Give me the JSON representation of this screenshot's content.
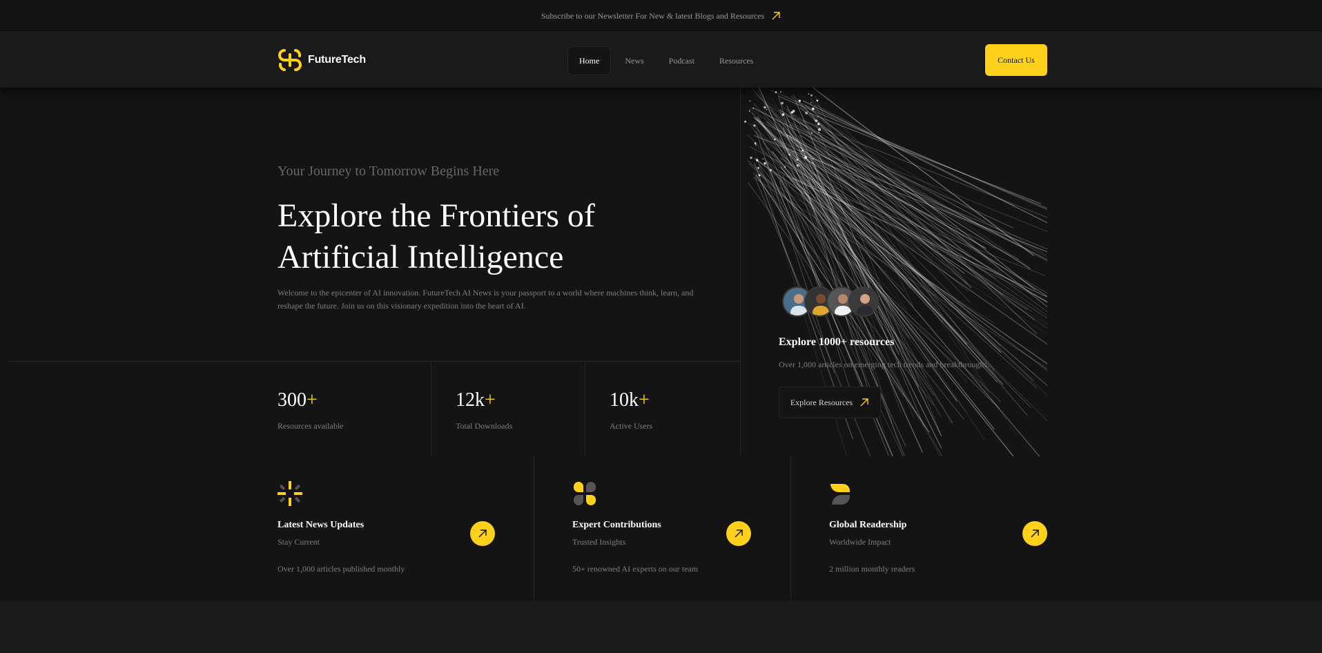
{
  "banner": {
    "text": "Subscribe to our Newsletter For New & latest Blogs and Resources"
  },
  "header": {
    "logo_text": "FutureTech",
    "nav": [
      {
        "label": "Home",
        "active": true
      },
      {
        "label": "News",
        "active": false
      },
      {
        "label": "Podcast",
        "active": false
      },
      {
        "label": "Resources",
        "active": false
      }
    ],
    "contact_label": "Contact Us"
  },
  "hero": {
    "tagline": "Your Journey to Tomorrow Begins Here",
    "headline_1": "Explore the Frontiers of",
    "headline_2": "Artificial Intelligence",
    "description": "Welcome to the epicenter of AI innovation. FutureTech AI News is your passport to a world where machines think, learn, and reshape the future. Join us on this visionary expedition into the heart of AI."
  },
  "stats": [
    {
      "value": "300",
      "suffix": "+",
      "label": "Resources available"
    },
    {
      "value": "12k",
      "suffix": "+",
      "label": "Total Downloads"
    },
    {
      "value": "10k",
      "suffix": "+",
      "label": "Active Users"
    }
  ],
  "resources_card": {
    "title": "Explore 1000+ resources",
    "description": "Over 1,000 articles on emerging tech trends and breakthroughs.",
    "button_label": "Explore Resources"
  },
  "features": [
    {
      "title": "Latest News Updates",
      "subtitle": "Stay Current",
      "detail": "Over 1,000 articles published monthly",
      "icon": "sparkle-icon"
    },
    {
      "title": "Expert Contributions",
      "subtitle": "Trusted Insights",
      "detail": "50+ renowned AI experts on our team",
      "icon": "clover-icon"
    },
    {
      "title": "Global Readership",
      "subtitle": "Worldwide Impact",
      "detail": "2 million monthly readers",
      "icon": "leaf-icon"
    }
  ],
  "colors": {
    "accent": "#ffd11a",
    "background": "#141414",
    "surface": "#1a1a1a",
    "border": "#262626",
    "muted_text": "#7e7e81"
  }
}
